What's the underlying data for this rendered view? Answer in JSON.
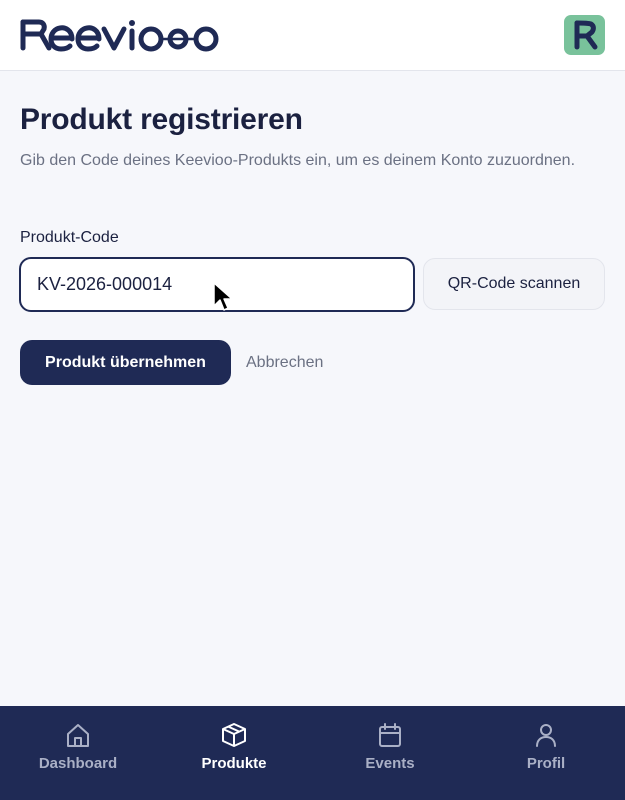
{
  "app": {
    "brand": "Keevioo",
    "colors": {
      "primary": "#1f2a55",
      "accent": "#79c29b",
      "background": "#f6f7fb"
    }
  },
  "header": {
    "logo_icon": "keevioo-logo",
    "avatar_icon": "keevioo-k-icon"
  },
  "main": {
    "title": "Produkt registrieren",
    "description": "Gib den Code deines Keevioo-Produkts ein, um es deinem Konto zuzuordnen.",
    "code_label": "Produkt-Code",
    "code_value": "KV-2026-000014",
    "qr_button": "QR-Code scannen",
    "submit_button": "Produkt übernehmen",
    "cancel_button": "Abbrechen"
  },
  "nav": {
    "items": [
      {
        "label": "Dashboard",
        "icon": "home-icon",
        "active": false
      },
      {
        "label": "Produkte",
        "icon": "box-icon",
        "active": true
      },
      {
        "label": "Events",
        "icon": "calendar-icon",
        "active": false
      },
      {
        "label": "Profil",
        "icon": "user-icon",
        "active": false
      }
    ]
  }
}
